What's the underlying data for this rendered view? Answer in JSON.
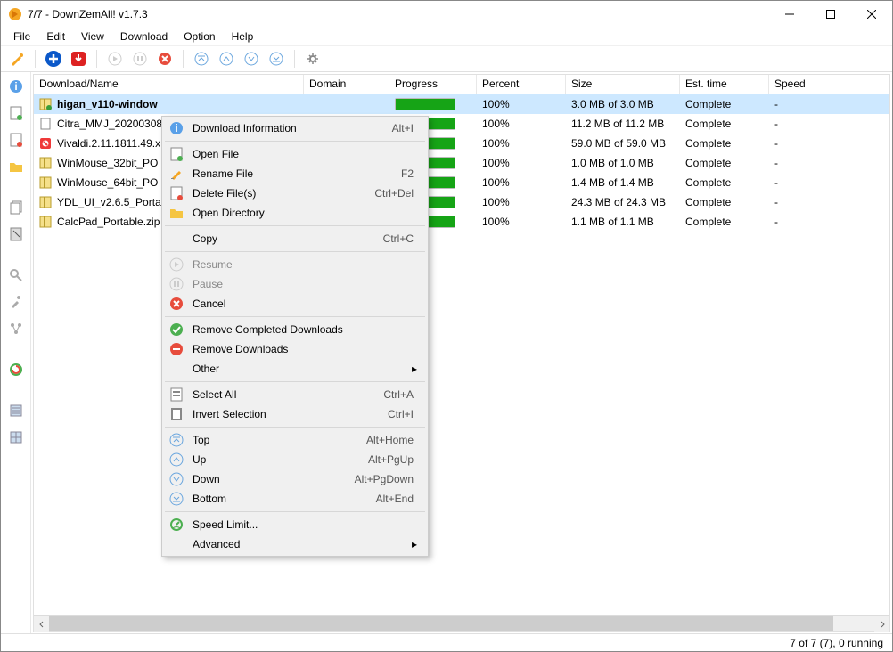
{
  "window": {
    "title": "7/7 - DownZemAll! v1.7.3"
  },
  "menubar": [
    "File",
    "Edit",
    "View",
    "Download",
    "Option",
    "Help"
  ],
  "columns": {
    "name": "Download/Name",
    "domain": "Domain",
    "progress": "Progress",
    "percent": "Percent",
    "size": "Size",
    "est": "Est. time",
    "speed": "Speed"
  },
  "rows": [
    {
      "name": "higan_v110-window",
      "icon": "zip-green",
      "percent": "100%",
      "size": "3.0 MB of 3.0 MB",
      "est": "Complete",
      "speed": "-",
      "selected": true
    },
    {
      "name": "Citra_MMJ_20200308",
      "icon": "file",
      "percent": "100%",
      "size": "11.2 MB of 11.2 MB",
      "est": "Complete",
      "speed": "-"
    },
    {
      "name": "Vivaldi.2.11.1811.49.x",
      "icon": "vivaldi",
      "percent": "100%",
      "size": "59.0 MB of 59.0 MB",
      "est": "Complete",
      "speed": "-"
    },
    {
      "name": "WinMouse_32bit_PO",
      "icon": "zip",
      "percent": "100%",
      "size": "1.0 MB of 1.0 MB",
      "est": "Complete",
      "speed": "-"
    },
    {
      "name": "WinMouse_64bit_PO",
      "icon": "zip",
      "percent": "100%",
      "size": "1.4 MB of 1.4 MB",
      "est": "Complete",
      "speed": "-"
    },
    {
      "name": "YDL_UI_v2.6.5_Portab",
      "icon": "zip",
      "percent": "100%",
      "size": "24.3 MB of 24.3 MB",
      "est": "Complete",
      "speed": "-"
    },
    {
      "name": "CalcPad_Portable.zip",
      "icon": "zip",
      "percent": "100%",
      "size": "1.1 MB of 1.1 MB",
      "est": "Complete",
      "speed": "-"
    }
  ],
  "contextmenu": [
    {
      "label": "Download Information",
      "shortcut": "Alt+I",
      "icon": "info"
    },
    {
      "sep": true
    },
    {
      "label": "Open File",
      "icon": "open"
    },
    {
      "label": "Rename File",
      "shortcut": "F2",
      "icon": "rename"
    },
    {
      "label": "Delete File(s)",
      "shortcut": "Ctrl+Del",
      "icon": "delete-file"
    },
    {
      "label": "Open Directory",
      "icon": "folder"
    },
    {
      "sep": true
    },
    {
      "label": "Copy",
      "shortcut": "Ctrl+C"
    },
    {
      "sep": true
    },
    {
      "label": "Resume",
      "icon": "play",
      "disabled": true
    },
    {
      "label": "Pause",
      "icon": "pause",
      "disabled": true
    },
    {
      "label": "Cancel",
      "icon": "cancel"
    },
    {
      "sep": true
    },
    {
      "label": "Remove Completed Downloads",
      "icon": "check-green"
    },
    {
      "label": "Remove Downloads",
      "icon": "minus-red"
    },
    {
      "label": "Other",
      "submenu": true
    },
    {
      "sep": true
    },
    {
      "label": "Select All",
      "shortcut": "Ctrl+A",
      "icon": "select-all"
    },
    {
      "label": "Invert Selection",
      "shortcut": "Ctrl+I",
      "icon": "invert"
    },
    {
      "sep": true
    },
    {
      "label": "Top",
      "shortcut": "Alt+Home",
      "icon": "top"
    },
    {
      "label": "Up",
      "shortcut": "Alt+PgUp",
      "icon": "up"
    },
    {
      "label": "Down",
      "shortcut": "Alt+PgDown",
      "icon": "down"
    },
    {
      "label": "Bottom",
      "shortcut": "Alt+End",
      "icon": "bottom"
    },
    {
      "sep": true
    },
    {
      "label": "Speed Limit...",
      "icon": "speed"
    },
    {
      "label": "Advanced",
      "submenu": true
    }
  ],
  "statusbar": "7 of 7 (7), 0 running"
}
